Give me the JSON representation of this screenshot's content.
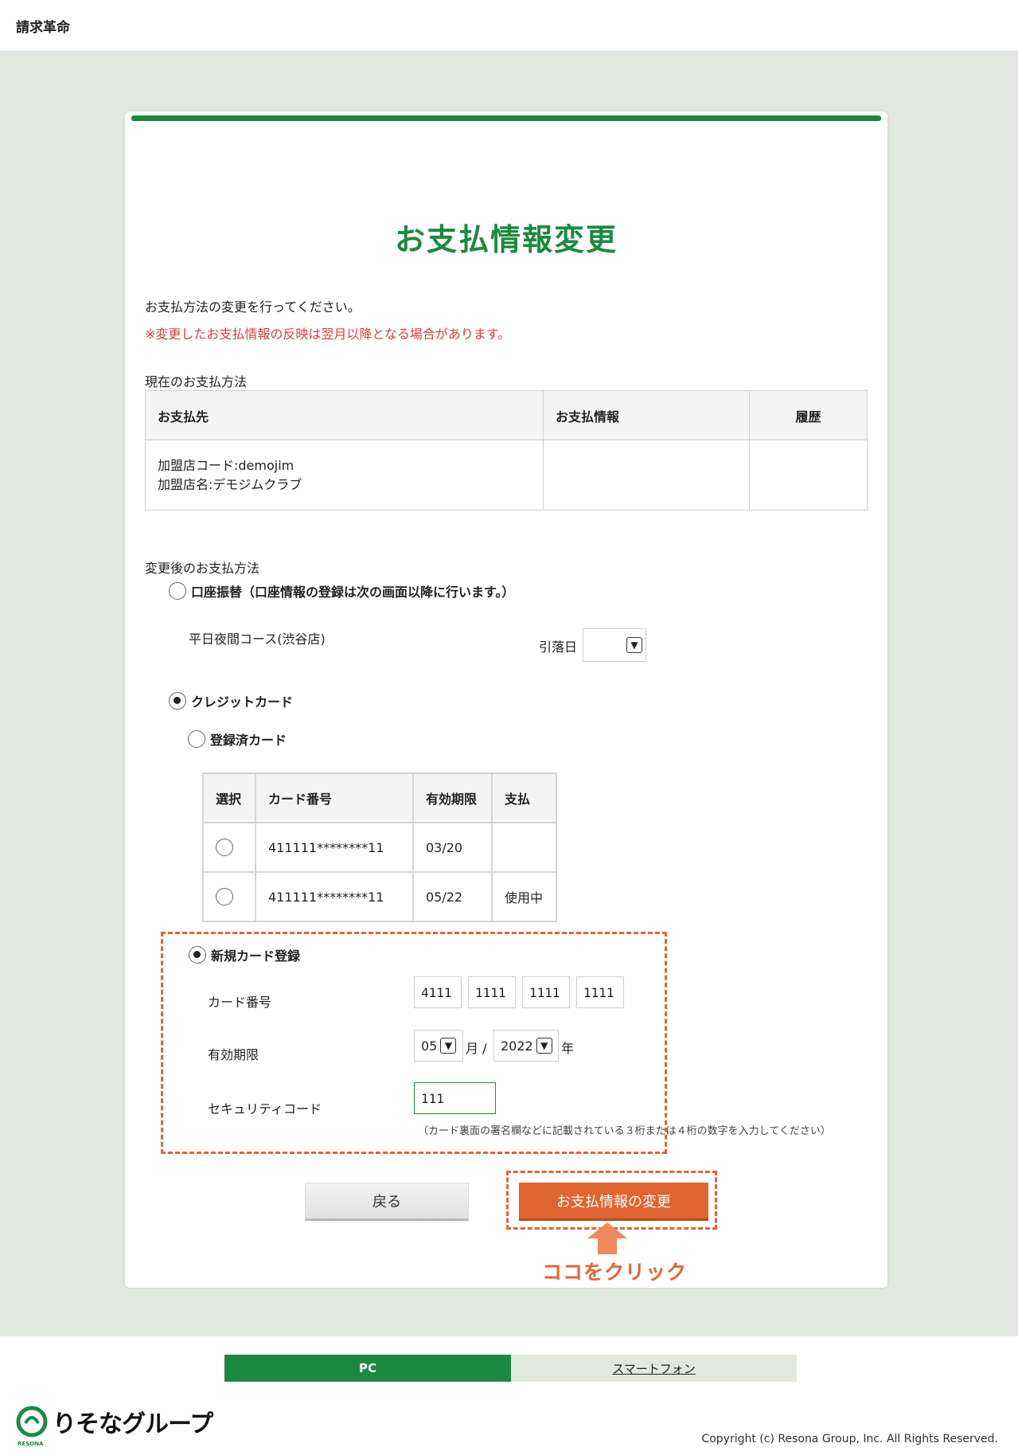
{
  "header": {
    "brand": "請求革命"
  },
  "page": {
    "title": "お支払情報変更",
    "intro": "お支払方法の変更を行ってください。",
    "notice": "※変更したお支払情報の反映は翌月以降となる場合があります。"
  },
  "current": {
    "label": "現在のお支払方法",
    "headers": [
      "お支払先",
      "お支払情報",
      "履歴"
    ],
    "merchant_code": "加盟店コード:demojim",
    "merchant_name": "加盟店名:デモジムクラブ",
    "payment_info": "",
    "history": ""
  },
  "change": {
    "label": "変更後のお支払方法",
    "bank_option": "口座振替（口座情報の登録は次の画面以降に行います。）",
    "course": "平日夜間コース(渋谷店)",
    "debit_day_label": "引落日",
    "credit_option": "クレジットカード",
    "registered_option": "登録済カード",
    "cards_headers": [
      "選択",
      "カード番号",
      "有効期限",
      "支払"
    ],
    "cards": [
      {
        "number": "411111********11",
        "expiry": "03/20",
        "status": ""
      },
      {
        "number": "411111********11",
        "expiry": "05/22",
        "status": "使用中"
      }
    ],
    "new_option": "新規カード登録",
    "card_number_label": "カード番号",
    "card_number": [
      "4111",
      "1111",
      "1111",
      "1111"
    ],
    "expiry_label": "有効期限",
    "expiry_month": "05",
    "month_unit": "月 /",
    "expiry_year": "2022",
    "year_unit": "年",
    "security_label": "セキュリティコード",
    "security_code": "111",
    "security_hint": "（カード裏面の署名欄などに記載されている３桁または４桁の数字を入力してください）"
  },
  "buttons": {
    "back": "戻る",
    "submit": "お支払情報の変更"
  },
  "callout": "ココをクリック",
  "footer": {
    "tab_pc": "PC",
    "tab_sp": "スマートフォン",
    "logo_text": "りそなグループ",
    "logo_sub": "RESONA",
    "copyright": "Copyright (c) Resona Group, Inc. All Rights Reserved."
  },
  "colors": {
    "brand_green": "#1b8a3f",
    "accent_orange": "#e0642f",
    "warning_red": "#e53b3b"
  }
}
